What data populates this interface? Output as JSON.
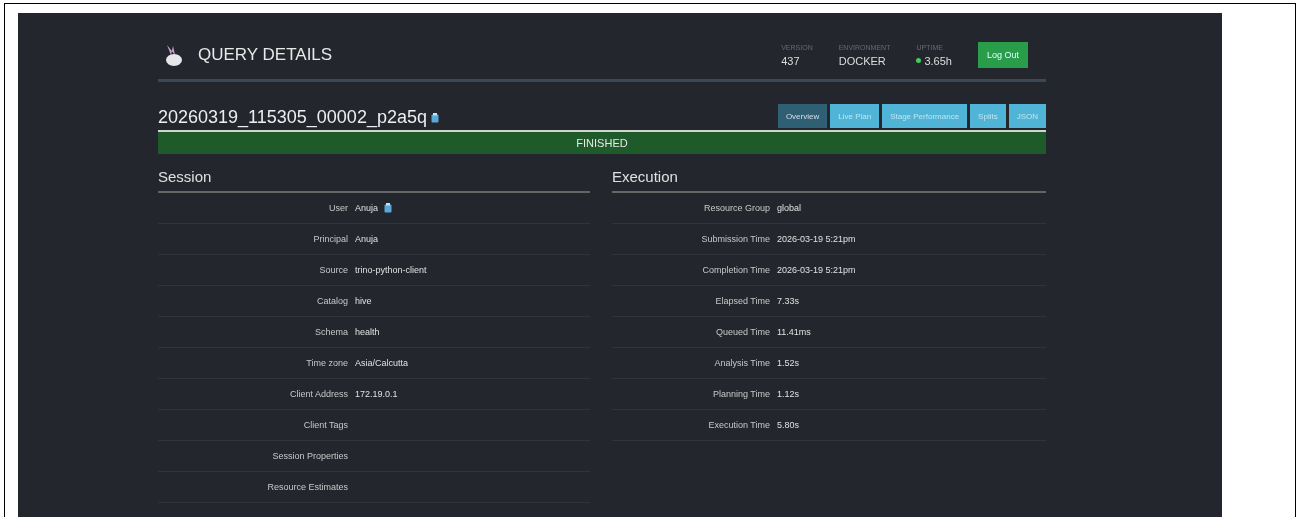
{
  "header": {
    "title": "QUERY DETAILS",
    "stats": [
      {
        "label": "VERSION",
        "value": "437",
        "kind": "plain"
      },
      {
        "label": "ENVIRONMENT",
        "value": "DOCKER",
        "kind": "plain"
      },
      {
        "label": "UPTIME",
        "value": "3.65h",
        "kind": "status"
      }
    ],
    "logout": "Log Out"
  },
  "query": {
    "id": "20260319_115305_00002_p2a5q",
    "state": "FINISHED"
  },
  "tabs": [
    {
      "label": "Overview",
      "selected": true
    },
    {
      "label": "Live Plan",
      "selected": false
    },
    {
      "label": "Stage Performance",
      "selected": false
    },
    {
      "label": "Splits",
      "selected": false
    },
    {
      "label": "JSON",
      "selected": false
    }
  ],
  "session": {
    "title": "Session",
    "rows": [
      {
        "label": "User",
        "value": "Anuja",
        "copy": true
      },
      {
        "label": "Principal",
        "value": "Anuja",
        "copy": false
      },
      {
        "label": "Source",
        "value": "trino-python-client",
        "copy": false
      },
      {
        "label": "Catalog",
        "value": "hive",
        "copy": false
      },
      {
        "label": "Schema",
        "value": "health",
        "copy": false
      },
      {
        "label": "Time zone",
        "value": "Asia/Calcutta",
        "copy": false
      },
      {
        "label": "Client Address",
        "value": "172.19.0.1",
        "copy": false
      },
      {
        "label": "Client Tags",
        "copy": false
      },
      {
        "label": "Session Properties",
        "copy": false
      },
      {
        "label": "Resource Estimates",
        "copy": false
      }
    ]
  },
  "execution": {
    "title": "Execution",
    "rows": [
      {
        "label": "Resource Group",
        "value": "global"
      },
      {
        "label": "Submission Time",
        "value": "2026-03-19 5:21pm"
      },
      {
        "label": "Completion Time",
        "value": "2026-03-19 5:21pm"
      },
      {
        "label": "Elapsed Time",
        "value": "7.33s"
      },
      {
        "label": "Queued Time",
        "value": "11.41ms"
      },
      {
        "label": "Analysis Time",
        "value": "1.52s"
      },
      {
        "label": "Planning Time",
        "value": "1.12s"
      },
      {
        "label": "Execution Time",
        "value": "5.80s"
      }
    ]
  }
}
